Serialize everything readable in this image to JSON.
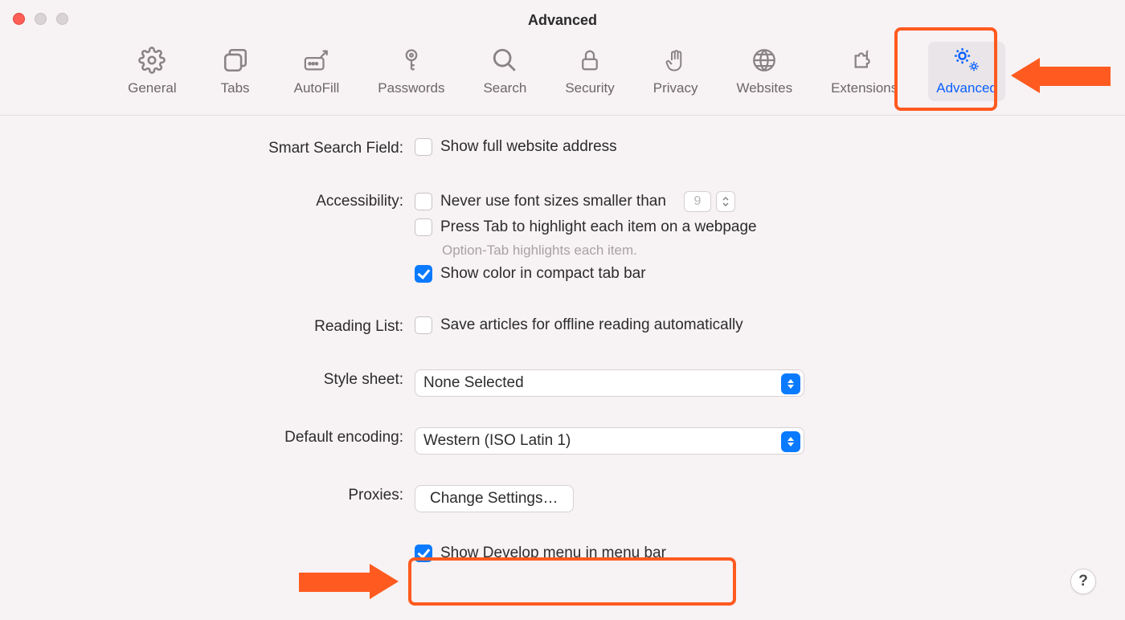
{
  "window": {
    "title": "Advanced"
  },
  "toolbar": {
    "tabs": [
      {
        "id": "general",
        "label": "General"
      },
      {
        "id": "tabs",
        "label": "Tabs"
      },
      {
        "id": "autofill",
        "label": "AutoFill"
      },
      {
        "id": "passwords",
        "label": "Passwords"
      },
      {
        "id": "search",
        "label": "Search"
      },
      {
        "id": "security",
        "label": "Security"
      },
      {
        "id": "privacy",
        "label": "Privacy"
      },
      {
        "id": "websites",
        "label": "Websites"
      },
      {
        "id": "extensions",
        "label": "Extensions"
      },
      {
        "id": "advanced",
        "label": "Advanced"
      }
    ],
    "active": "advanced"
  },
  "sections": {
    "smart_search": {
      "label": "Smart Search Field:",
      "show_full_address": "Show full website address"
    },
    "accessibility": {
      "label": "Accessibility:",
      "never_font": "Never use font sizes smaller than",
      "font_size": "9",
      "press_tab": "Press Tab to highlight each item on a webpage",
      "helper": "Option-Tab highlights each item.",
      "show_color": "Show color in compact tab bar"
    },
    "reading_list": {
      "label": "Reading List:",
      "save_offline": "Save articles for offline reading automatically"
    },
    "style_sheet": {
      "label": "Style sheet:",
      "value": "None Selected"
    },
    "default_encoding": {
      "label": "Default encoding:",
      "value": "Western (ISO Latin 1)"
    },
    "proxies": {
      "label": "Proxies:",
      "button": "Change Settings…"
    },
    "develop": {
      "label": "Show Develop menu in menu bar"
    }
  },
  "help_button": "?"
}
